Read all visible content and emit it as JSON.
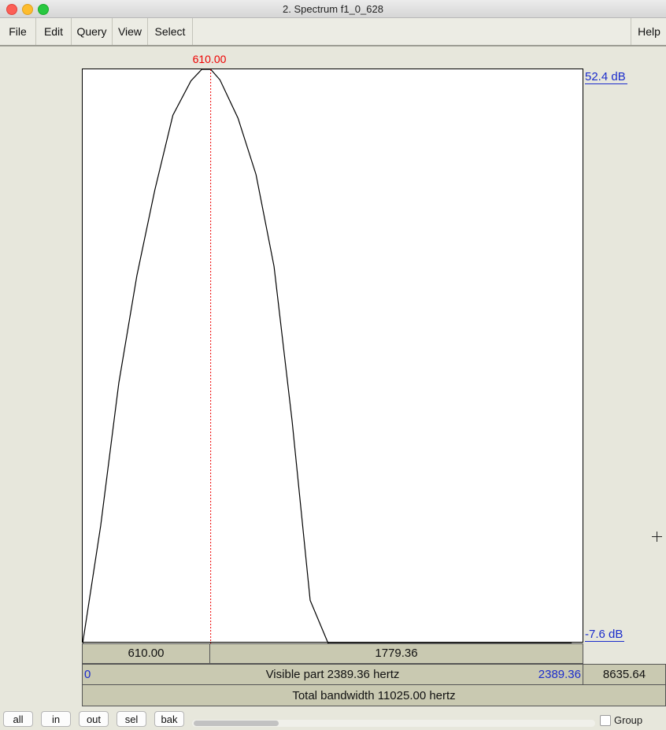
{
  "window": {
    "title": "2. Spectrum f1_0_628"
  },
  "menu": {
    "file": "File",
    "edit": "Edit",
    "query": "Query",
    "view": "View",
    "select": "Select",
    "help": "Help"
  },
  "plot": {
    "cursor_frequency": "610.00",
    "db_max": "52.4 dB",
    "db_min": "-7.6 dB",
    "left_segment": "610.00",
    "right_segment": "1779.36",
    "visible_start": "0",
    "visible_label": "Visible part 2389.36 hertz",
    "visible_end": "2389.36",
    "remaining": "8635.64",
    "total_label": "Total bandwidth 11025.00 hertz"
  },
  "chart_data": {
    "type": "line",
    "x_unit": "Hz",
    "y_unit": "dB",
    "xlim": [
      0,
      2389.36
    ],
    "ylim": [
      -7.6,
      52.4
    ],
    "cursor_x": 610,
    "x": [
      0,
      86,
      172,
      258,
      344,
      430,
      516,
      568,
      610,
      654,
      740,
      826,
      912,
      998,
      1084,
      1170,
      1220,
      2330
    ],
    "y": [
      -7.6,
      4.7,
      19.6,
      30.8,
      39.8,
      47.6,
      51.2,
      52.4,
      52.4,
      51.3,
      47.3,
      41.4,
      31.8,
      15.6,
      -3.1,
      -7.6,
      -7.6,
      -7.6
    ]
  },
  "buttons": {
    "all": "all",
    "in": "in",
    "out": "out",
    "sel": "sel",
    "bak": "bak"
  },
  "group_label": "Group"
}
